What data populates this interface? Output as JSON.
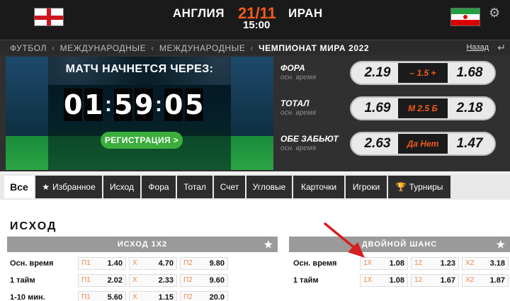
{
  "match": {
    "home": "АНГЛИЯ",
    "away": "ИРАН",
    "date": "21/11",
    "time": "15:00"
  },
  "breadcrumb": {
    "items": [
      "ФУТБОЛ",
      "МЕЖДУНАРОДНЫЕ",
      "МЕЖДУНАРОДНЫЕ",
      "ЧЕМПИОНАТ МИРА 2022"
    ],
    "back_label": "Назад"
  },
  "promo": {
    "countdown_title": "МАТЧ НАЧНЕТСЯ ЧЕРЕЗ:",
    "digits": [
      "0",
      "1",
      "5",
      "9",
      "0",
      "5"
    ],
    "colon": ":",
    "register_label": "РЕГИСТРАЦИЯ >"
  },
  "markets": [
    {
      "name": "ФОРА",
      "sub": "осн. время",
      "odd1": "2.19",
      "middle": "– 1.5 +",
      "odd2": "1.68"
    },
    {
      "name": "ТОТАЛ",
      "sub": "осн. время",
      "odd1": "1.69",
      "middle": "М 2.5 Б",
      "odd2": "2.18"
    },
    {
      "name": "ОБЕ ЗАБЬЮТ",
      "sub": "осн. время",
      "odd1": "2.63",
      "middle": "Да   Нет",
      "odd2": "1.47"
    }
  ],
  "tabs": [
    {
      "label": "Все",
      "icon": ""
    },
    {
      "label": "Избранное",
      "icon": "★"
    },
    {
      "label": "Исход",
      "icon": ""
    },
    {
      "label": "Фора",
      "icon": ""
    },
    {
      "label": "Тотал",
      "icon": ""
    },
    {
      "label": "Счет",
      "icon": ""
    },
    {
      "label": "Угловые",
      "icon": ""
    },
    {
      "label": "Карточки",
      "icon": ""
    },
    {
      "label": "Игроки",
      "icon": ""
    },
    {
      "label": "Турниры",
      "icon": "🏆"
    }
  ],
  "section": {
    "title": "ИСХОД",
    "panel1": {
      "header": "ИСХОД 1X2",
      "rows": [
        {
          "label": "Осн. время",
          "cells": [
            [
              "П1",
              "1.40"
            ],
            [
              "Х",
              "4.70"
            ],
            [
              "П2",
              "9.80"
            ]
          ]
        },
        {
          "label": "1 тайм",
          "cells": [
            [
              "П1",
              "2.02"
            ],
            [
              "Х",
              "2.33"
            ],
            [
              "П2",
              "9.60"
            ]
          ]
        },
        {
          "label": "1-10 мин.",
          "cells": [
            [
              "П1",
              "5.60"
            ],
            [
              "Х",
              "1.15"
            ],
            [
              "П2",
              "20.0"
            ]
          ]
        }
      ]
    },
    "panel2": {
      "header": "ДВОЙНОЙ ШАНС",
      "rows": [
        {
          "label": "Осн. время",
          "cells": [
            [
              "1Х",
              "1.08"
            ],
            [
              "12",
              "1.23"
            ],
            [
              "Х2",
              "3.18"
            ]
          ]
        },
        {
          "label": "1 тайм",
          "cells": [
            [
              "1Х",
              "1.08"
            ],
            [
              "12",
              "1.67"
            ],
            [
              "Х2",
              "1.87"
            ]
          ]
        }
      ]
    },
    "star": "★"
  },
  "icons": {
    "settings": "gear-icon",
    "back": "back-icon",
    "favorite": "star-icon",
    "arrow_color": "#d61f1f",
    "accent": "#f25a1e"
  }
}
